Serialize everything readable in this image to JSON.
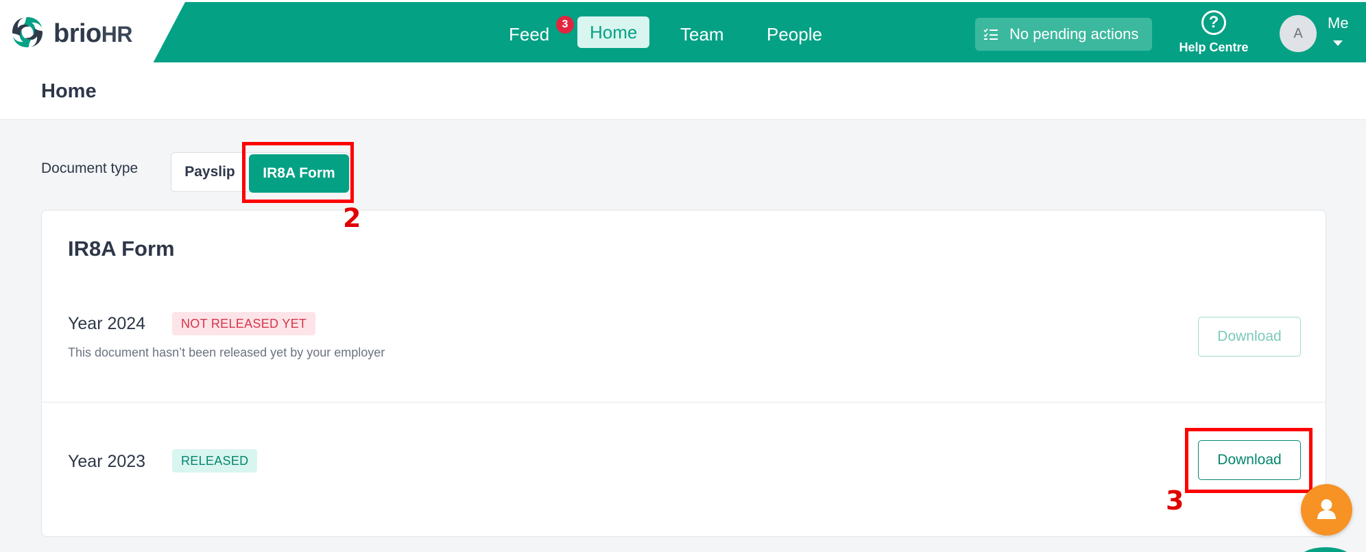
{
  "header": {
    "logo": {
      "brand": "brio",
      "suffix": "HR"
    },
    "nav": [
      {
        "label": "Feed"
      },
      {
        "label": "Home"
      },
      {
        "label": "Team"
      },
      {
        "label": "People"
      }
    ],
    "feed_badge": "3",
    "pending_actions": "No pending actions",
    "help_label": "Help Centre",
    "help_icon": "question-circle-icon",
    "avatar_initial": "A",
    "user_label": "Me"
  },
  "page": {
    "title": "Home",
    "doc_type_label": "Document type",
    "doc_types": [
      {
        "label": "Payslip"
      },
      {
        "label": "IR8A Form"
      }
    ]
  },
  "card": {
    "title": "IR8A Form",
    "rows": [
      {
        "year": "Year 2024",
        "status": "NOT RELEASED YET",
        "note": "This document hasn’t been released yet by your employer",
        "download": "Download"
      },
      {
        "year": "Year 2023",
        "status": "RELEASED",
        "note": "",
        "download": "Download"
      }
    ]
  },
  "annotations": {
    "step_2": "2",
    "step_3": "3"
  },
  "colors": {
    "brand": "#04a185",
    "annotation": "#ff0000",
    "chat": "#f79225"
  }
}
